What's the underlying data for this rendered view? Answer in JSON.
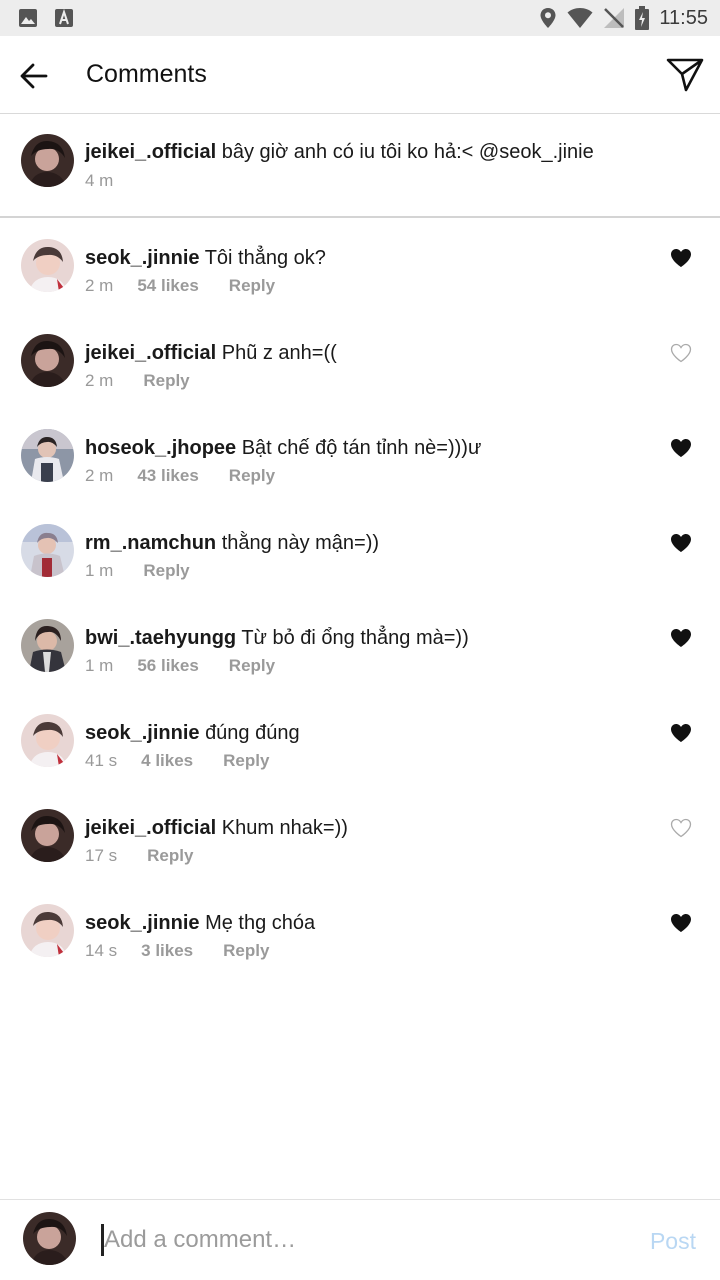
{
  "status_bar": {
    "time": "11:55",
    "icons": [
      "image-icon",
      "font-icon",
      "location-icon",
      "wifi-icon",
      "no-signal-icon",
      "battery-charging-icon"
    ]
  },
  "header": {
    "title": "Comments"
  },
  "caption": {
    "username": "jeikei_.official",
    "text": "bây giờ anh có iu tôi ko hả:< @seok_.jinie",
    "time": "4 m"
  },
  "comments": [
    {
      "username": "seok_.jinnie",
      "text": "Tôi thẳng ok?",
      "time": "2 m",
      "likes": "54 likes",
      "reply": "Reply",
      "liked": true
    },
    {
      "username": "jeikei_.official",
      "text": "Phũ z anh=((",
      "time": "2 m",
      "likes": "",
      "reply": "Reply",
      "liked": false
    },
    {
      "username": "hoseok_.jhopee",
      "text": "Bật chế độ tán tỉnh nè=)))ư",
      "time": "2 m",
      "likes": "43 likes",
      "reply": "Reply",
      "liked": true
    },
    {
      "username": "rm_.namchun",
      "text": "thằng này mận=))",
      "time": "1 m",
      "likes": "",
      "reply": "Reply",
      "liked": true
    },
    {
      "username": "bwi_.taehyungg",
      "text": "Từ bỏ đi ổng thẳng mà=))",
      "time": "1 m",
      "likes": "56 likes",
      "reply": "Reply",
      "liked": true
    },
    {
      "username": "seok_.jinnie",
      "text": "đúng đúng",
      "time": "41 s",
      "likes": "4 likes",
      "reply": "Reply",
      "liked": true
    },
    {
      "username": "jeikei_.official",
      "text": "Khum nhak=))",
      "time": "17 s",
      "likes": "",
      "reply": "Reply",
      "liked": false
    },
    {
      "username": "seok_.jinnie",
      "text": "Mẹ thg chóa",
      "time": "14 s",
      "likes": "3 likes",
      "reply": "Reply",
      "liked": true
    }
  ],
  "composer": {
    "placeholder": "Add a comment…",
    "post_label": "Post"
  },
  "colors": {
    "accent_disabled": "#b9d7f3",
    "meta_gray": "#8e8e8e",
    "status_bar_bg": "#ededed"
  }
}
